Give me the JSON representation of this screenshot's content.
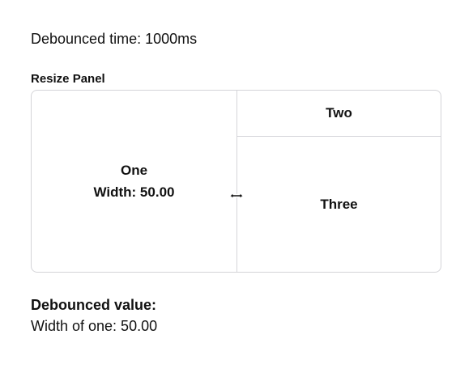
{
  "debounce": {
    "time_label": "Debounced time: 1000ms"
  },
  "resize_panel": {
    "title": "Resize Panel",
    "panel_one": {
      "label": "One",
      "width_text": "Width: 50.00"
    },
    "panel_two": {
      "label": "Two"
    },
    "panel_three": {
      "label": "Three"
    },
    "cursor_icon": "resize-horizontal-cursor"
  },
  "result": {
    "heading": "Debounced value:",
    "value_text": "Width of one: 50.00"
  },
  "colors": {
    "border": "#d4d4d8",
    "text": "#111111",
    "background": "#ffffff"
  }
}
